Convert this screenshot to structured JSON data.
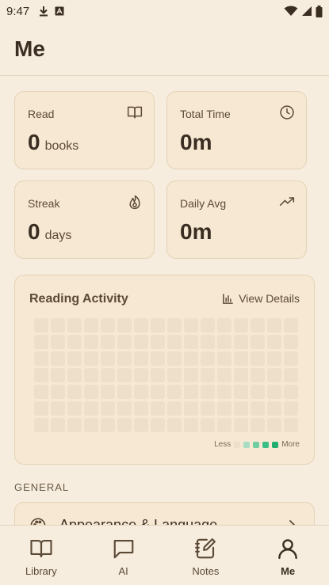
{
  "status_bar": {
    "time": "9:47",
    "left_icons": [
      "download-icon",
      "keyboard-icon"
    ],
    "right_icons": [
      "wifi-icon",
      "signal-icon",
      "battery-icon"
    ]
  },
  "header": {
    "title": "Me"
  },
  "stats": [
    {
      "label": "Read",
      "value": "0",
      "unit": "books",
      "icon": "book-open-icon"
    },
    {
      "label": "Total Time",
      "value": "0m",
      "unit": "",
      "icon": "clock-icon"
    },
    {
      "label": "Streak",
      "value": "0",
      "unit": "days",
      "icon": "flame-icon"
    },
    {
      "label": "Daily Avg",
      "value": "0m",
      "unit": "",
      "icon": "trending-up-icon"
    }
  ],
  "activity": {
    "title": "Reading Activity",
    "view_details_label": "View Details",
    "legend_less": "Less",
    "legend_more": "More",
    "legend_colors": [
      "#EDDFC9",
      "#A8DDC2",
      "#6FCDA0",
      "#3CBF86",
      "#1FAE70"
    ],
    "empty_cell_color": "#EDDFC9"
  },
  "general": {
    "section_label": "GENERAL",
    "items": [
      {
        "label": "Appearance & Language",
        "icon": "palette-icon"
      }
    ]
  },
  "nav": {
    "items": [
      {
        "label": "Library",
        "icon": "book-open-icon",
        "active": false
      },
      {
        "label": "AI",
        "icon": "chat-bubble-icon",
        "active": false
      },
      {
        "label": "Notes",
        "icon": "notebook-pen-icon",
        "active": false
      },
      {
        "label": "Me",
        "icon": "user-icon",
        "active": true
      }
    ]
  },
  "colors": {
    "background": "#F6EDDE",
    "card": "#F7E8D3",
    "text": "#3A2E22",
    "accent_green": "#1FAE70"
  }
}
